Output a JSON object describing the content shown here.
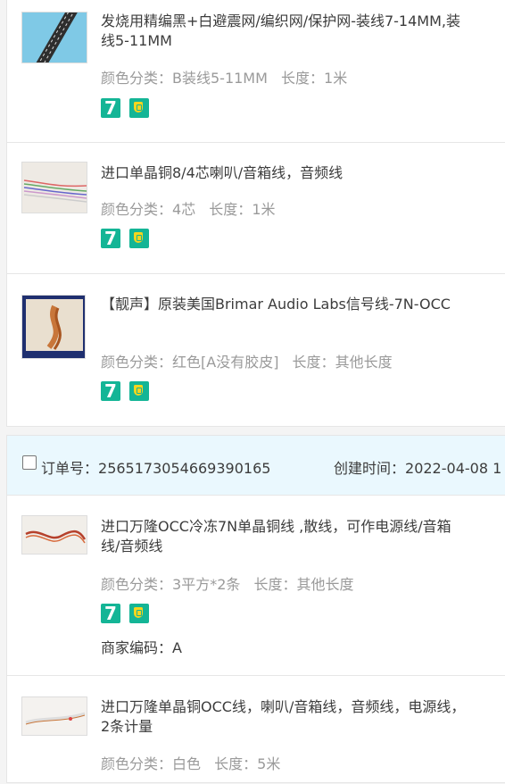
{
  "order1": {
    "items": [
      {
        "title": "发烧用精编黑+白避震网/编织网/保护网-装线7-14MM,装线5-11MM",
        "color_label": "颜色分类：",
        "color_value": "B装线5-11MM",
        "length_label": "长度：",
        "length_value": "1米",
        "price": "¥",
        "thumb_icon": "braided-sleeve-image"
      },
      {
        "title": "进口单晶铜8/4芯喇叭/音箱线，音频线",
        "color_label": "颜色分类：",
        "color_value": "4芯",
        "length_label": "长度：",
        "length_value": "1米",
        "price": "¥",
        "thumb_icon": "multicolor-wire-image"
      },
      {
        "title": "【靓声】原装美国Brimar Audio Labs信号线-7N-OCC",
        "color_label": "颜色分类：",
        "color_value": "红色[A没有胶皮]",
        "length_label": "长度：",
        "length_value": "其他长度",
        "price": "¥",
        "thumb_icon": "copper-cable-image"
      }
    ]
  },
  "order2": {
    "order_no_label": "订单号：",
    "order_no": "2565173054669390165",
    "created_label": "创建时间：",
    "created_time": "2022-04-08 1",
    "items": [
      {
        "title": "进口万隆OCC冷冻7N单晶铜线 ,散线，可作电源线/音箱线/音频线",
        "color_label": "颜色分类：",
        "color_value": "3平方*2条",
        "length_label": "长度：",
        "length_value": "其他长度",
        "merchant": "商家编码：A",
        "price": "¥",
        "thumb_icon": "red-wire-image"
      },
      {
        "title": "进口万隆单晶铜OCC线，喇叭/音箱线，音频线，电源线，2条计量",
        "color_label": "颜色分类：",
        "color_value": "白色",
        "length_label": "长度：",
        "length_value": "5米",
        "price": "¥",
        "thumb_icon": "white-wire-image"
      }
    ]
  },
  "badges": {
    "seven_day": "7"
  },
  "colors": {
    "accent": "#14b596",
    "order_header_bg": "#eaf8fe",
    "muted_text": "#9a9a9a"
  }
}
